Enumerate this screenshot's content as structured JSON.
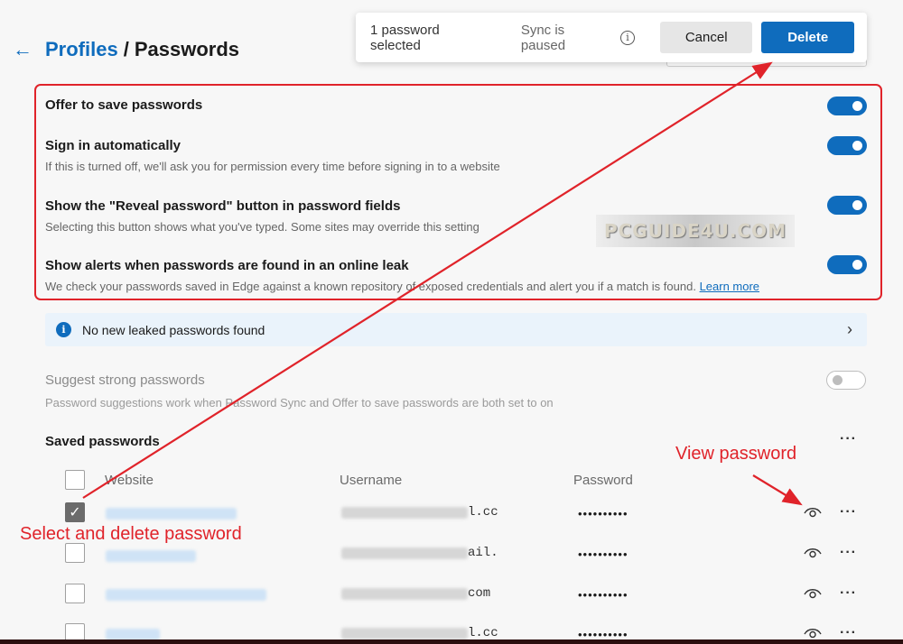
{
  "header": {
    "back_glyph": "←",
    "crumb_profiles": "Profiles",
    "separator": "/",
    "crumb_passwords": "Passwords"
  },
  "action_bar": {
    "selected_text": "1 password selected",
    "sync_text": "Sync is paused",
    "info_glyph": "i",
    "cancel_label": "Cancel",
    "delete_label": "Delete"
  },
  "settings": [
    {
      "title": "Offer to save passwords",
      "desc": "",
      "enabled": true
    },
    {
      "title": "Sign in automatically",
      "desc": "If this is turned off, we'll ask you for permission every time before signing in to a website",
      "enabled": true
    },
    {
      "title": "Show the \"Reveal password\" button in password fields",
      "desc": "Selecting this button shows what you've typed. Some sites may override this setting",
      "enabled": true
    },
    {
      "title": "Show alerts when passwords are found in an online leak",
      "desc": "We check your passwords saved in Edge against a known repository of exposed credentials and alert you if a match is found.",
      "link": "Learn more",
      "enabled": true
    }
  ],
  "watermark": "PCGUIDE4U.COM",
  "leak_banner": {
    "icon_glyph": "i",
    "text": "No new leaked passwords found",
    "chevron": "›"
  },
  "suggest": {
    "title": "Suggest strong passwords",
    "desc": "Password suggestions work when Password Sync and Offer to save passwords are both set to on",
    "enabled": false
  },
  "saved": {
    "title": "Saved passwords",
    "more_glyph": "···",
    "columns": {
      "website": "Website",
      "username": "Username",
      "password": "Password"
    },
    "rows": [
      {
        "checked": true,
        "username_tail": "l.cc",
        "password": "••••••••••"
      },
      {
        "checked": false,
        "username_tail": "ail.",
        "password": "••••••••••"
      },
      {
        "checked": false,
        "username_tail": "com",
        "password": "••••••••••"
      },
      {
        "checked": false,
        "username_tail": "l.cc",
        "password": "••••••••••"
      }
    ]
  },
  "annotations": {
    "select_delete": "Select and delete password",
    "view_password": "View password"
  },
  "colors": {
    "accent": "#0f6cbd",
    "annotation": "#e0232a"
  }
}
